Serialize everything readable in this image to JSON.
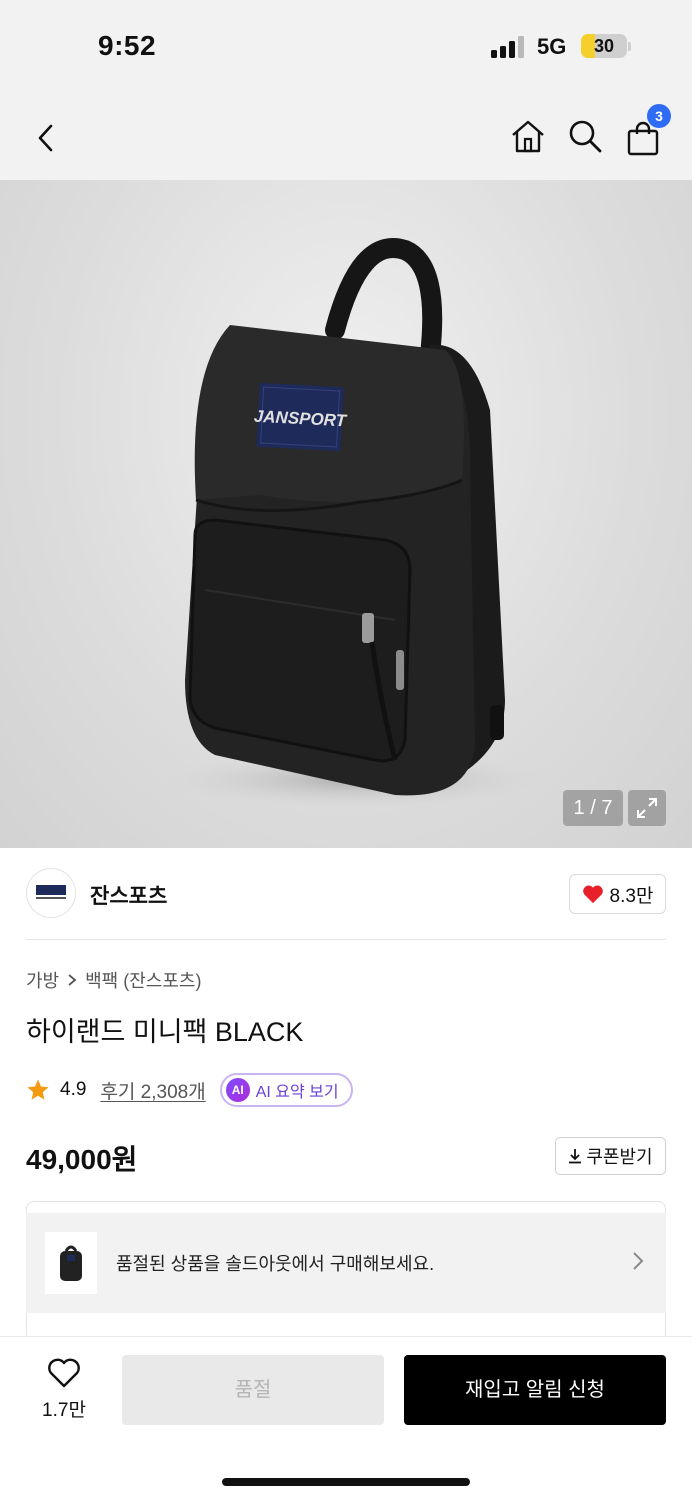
{
  "status": {
    "time": "9:52",
    "network": "5G",
    "battery": "30",
    "battery_level": 0.3
  },
  "header": {
    "cart_count": "3"
  },
  "gallery": {
    "pager": "1 / 7",
    "brand_patch": "JANSPORT"
  },
  "brand": {
    "name": "잔스포츠",
    "likes": "8.3만"
  },
  "breadcrumb": {
    "category": "가방",
    "subcategory": "백팩 (잔스포츠)"
  },
  "product": {
    "title": "하이랜드 미니팩 BLACK",
    "price": "49,000원"
  },
  "rating": {
    "score": "4.9",
    "reviews": "후기 2,308개",
    "ai_badge": "AI",
    "ai_label": "AI 요약 보기"
  },
  "coupon": {
    "label": "쿠폰받기"
  },
  "soldout_banner": {
    "text": "품절된 상품을 솔드아웃에서 구매해보세요."
  },
  "bottom": {
    "wish_count": "1.7만",
    "soldout_label": "품절",
    "restock_label": "재입고 알림 신청"
  },
  "colors": {
    "accent_blue": "#2f6cf6",
    "heart_red": "#e8202a",
    "ai_purple": "#6b3fd6",
    "star": "#f39c12"
  }
}
